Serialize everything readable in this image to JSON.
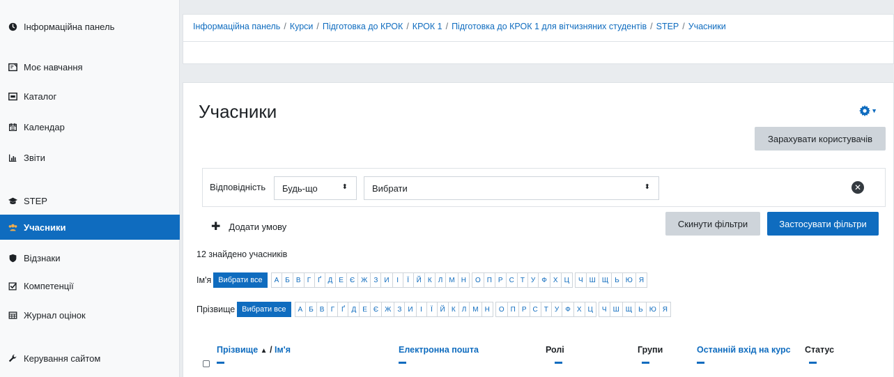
{
  "sidebar": {
    "items": [
      {
        "label": "Інформаційна панель",
        "icon": "dashboard-icon"
      },
      {
        "label": "Моє навчання",
        "icon": "my-learning-icon"
      },
      {
        "label": "Каталог",
        "icon": "catalog-icon"
      },
      {
        "label": "Календар",
        "icon": "calendar-icon"
      },
      {
        "label": "Звіти",
        "icon": "reports-icon"
      },
      {
        "label": "STEP",
        "icon": "graduation-cap-icon"
      },
      {
        "label": "Учасники",
        "icon": "users-icon"
      },
      {
        "label": "Відзнаки",
        "icon": "shield-icon"
      },
      {
        "label": "Компетенції",
        "icon": "checkbox-icon"
      },
      {
        "label": "Журнал оцінок",
        "icon": "table-icon"
      },
      {
        "label": "Керування сайтом",
        "icon": "wrench-icon"
      }
    ],
    "active_index": 6
  },
  "breadcrumb": {
    "items": [
      "Інформаційна панель",
      "Курси",
      "Підготовка до КРОК",
      "КРОК 1",
      "Підготовка до КРОК 1 для вітчизняних студентів",
      "STEP",
      "Учасники"
    ],
    "separator": "/"
  },
  "page": {
    "title": "Учасники",
    "enrol_button": "Зарахувати користувачів"
  },
  "filter": {
    "match_label": "Відповідність",
    "match_value": "Будь-що",
    "select_placeholder": "Вибрати",
    "add_condition": "Додати умову",
    "reset_button": "Скинути фільтри",
    "apply_button": "Застосувати фільтри"
  },
  "found_text": "12 знайдено учасників",
  "initials": {
    "firstname_label": "Ім'я",
    "lastname_label": "Прізвище",
    "all_label": "Вибрати все",
    "letters": [
      "А",
      "Б",
      "В",
      "Г",
      "Ґ",
      "Д",
      "Е",
      "Є",
      "Ж",
      "З",
      "И",
      "І",
      "Ї",
      "Й",
      "К",
      "Л",
      "М",
      "Н",
      "О",
      "П",
      "Р",
      "С",
      "Т",
      "У",
      "Ф",
      "Х",
      "Ц",
      "Ч",
      "Ш",
      "Щ",
      "Ь",
      "Ю",
      "Я"
    ]
  },
  "table": {
    "lastname_header": "Прізвище",
    "firstname_header": "Ім'я",
    "email_header": "Електронна пошта",
    "roles_header": "Ролі",
    "groups_header": "Групи",
    "lastaccess_header": "Останній вхід на курс",
    "status_header": "Статус",
    "sort_arrow": "▲",
    "name_separator": "/"
  },
  "colors": {
    "accent": "#0f6cbf",
    "sidebar_bg": "#f8f9fa",
    "page_bg": "#e9ecef"
  }
}
